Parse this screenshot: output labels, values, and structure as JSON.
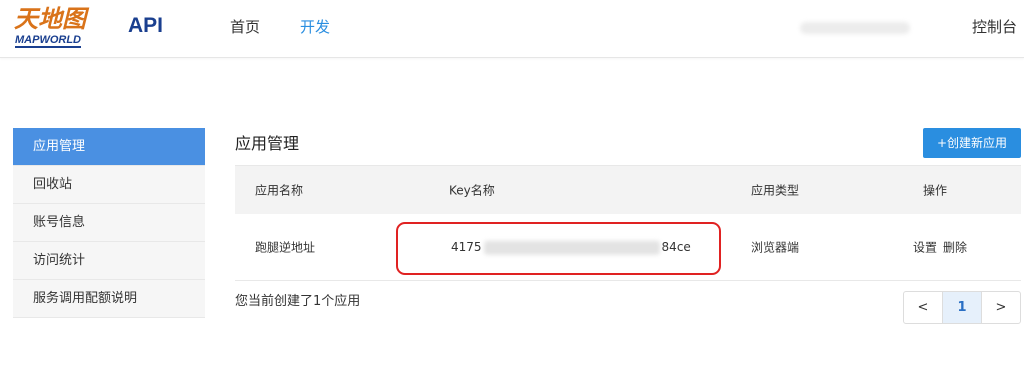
{
  "header": {
    "logo_cn": "天地图",
    "logo_en": "MAPWORLD",
    "logo_api": "API",
    "nav": [
      {
        "label": "首页"
      },
      {
        "label": "开发"
      }
    ],
    "console_label": "控制台"
  },
  "sidebar": {
    "items": [
      {
        "label": "应用管理",
        "active": true
      },
      {
        "label": "回收站"
      },
      {
        "label": "账号信息"
      },
      {
        "label": "访问统计"
      },
      {
        "label": "服务调用配额说明"
      }
    ]
  },
  "main": {
    "title": "应用管理",
    "create_button": "+创建新应用",
    "table": {
      "headers": [
        "应用名称",
        "Key名称",
        "应用类型",
        "操作"
      ],
      "rows": [
        {
          "app_name": "跑腿逆地址",
          "key_prefix": "4175",
          "key_suffix": "84ce",
          "app_type": "浏览器端",
          "op_settings": "设置",
          "op_delete": "删除"
        }
      ]
    },
    "footer_text": "您当前创建了1个应用",
    "pagination": {
      "prev": "<",
      "current": "1",
      "next": ">"
    }
  },
  "colors": {
    "accent": "#2a8ee0",
    "sidebar_active": "#4a90e2",
    "highlight_border": "#e02222",
    "logo_orange": "#d9731a",
    "logo_blue": "#1a3f8f"
  }
}
